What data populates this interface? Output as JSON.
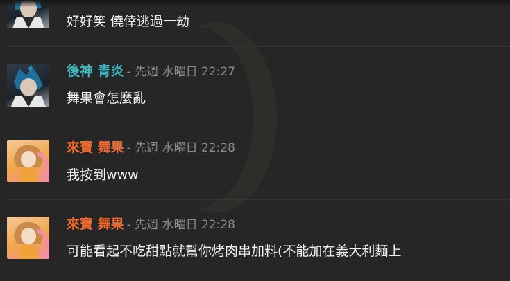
{
  "messages": [
    {
      "author": "",
      "meta": "",
      "text": "好好笑 僥倖逃過一劫",
      "avatar": "blue-hair-avatar-icon"
    },
    {
      "author": "後神 青炎",
      "meta": "- 先週 水曜日 22:27",
      "text": "舞果會怎麼亂",
      "author_color": "#3fb8bf",
      "avatar": "blue-hair-avatar-icon"
    },
    {
      "author": "來寶 舞果",
      "meta": "- 先週 水曜日 22:28",
      "text": "我按到www",
      "author_color": "#f26b2e",
      "avatar": "orange-hair-avatar-icon"
    },
    {
      "author": "來寶 舞果",
      "meta": "- 先週 水曜日 22:28",
      "text": "可能看起不吃甜點就幫你烤肉串加料(不能加在義大利麵上",
      "author_color": "#f26b2e",
      "avatar": "orange-hair-avatar-icon"
    }
  ],
  "colors": {
    "background": "#262626",
    "divider": "#353535",
    "timestamp": "#8a8a8a",
    "message_text": "#f2f2f2"
  }
}
